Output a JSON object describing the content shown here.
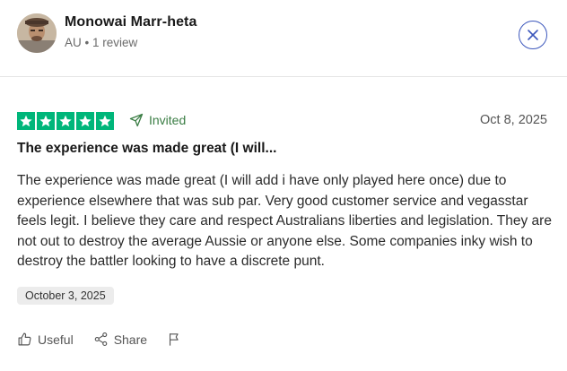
{
  "reviewer": {
    "name": "Monowai Marr-heta",
    "meta": "AU • 1 review"
  },
  "review": {
    "rating": 5,
    "invited_label": "Invited",
    "date": "Oct 8, 2025",
    "title": "The experience was made great (I will...",
    "body": "The experience was made great (I will add i have only played here once) due to experience elsewhere that was sub par. Very good customer service and vegasstar feels legit. I believe they care and respect Australians liberties and legislation. They are not out to destroy the average Aussie or anyone else. Some companies inky wish to destroy the battler looking to have a discrete punt.",
    "experience_date": "October 3, 2025"
  },
  "actions": {
    "useful_label": "Useful",
    "share_label": "Share"
  },
  "icons": [
    "close-icon",
    "star-icon",
    "invited-arrow-icon",
    "thumbs-up-icon",
    "share-icon",
    "flag-icon"
  ],
  "colors": {
    "star_green": "#00b67a",
    "invited_green": "#3a7d44",
    "close_blue": "#3c57bc"
  }
}
